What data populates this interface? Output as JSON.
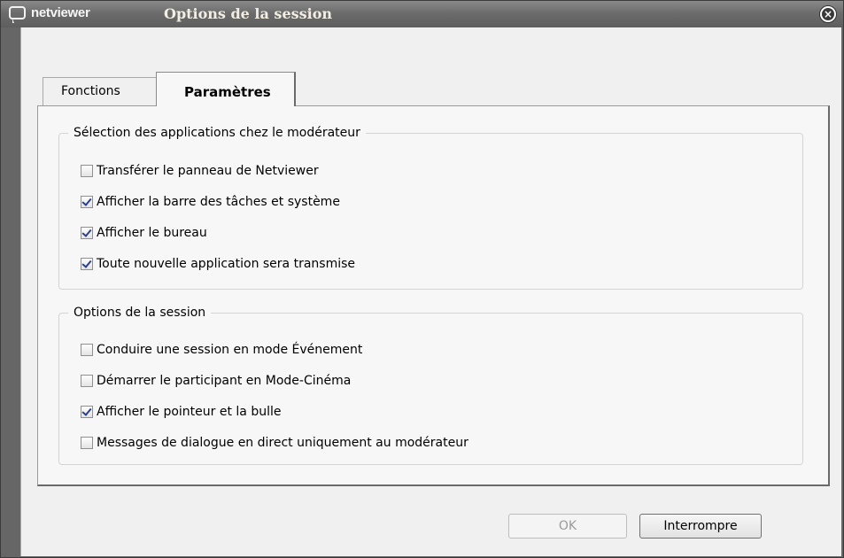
{
  "window": {
    "brand": "netviewer",
    "title": "Options de la session",
    "close_glyph": "×"
  },
  "tabs": [
    {
      "label": "Fonctions",
      "active": false
    },
    {
      "label": "Paramètres",
      "active": true
    }
  ],
  "groups": [
    {
      "legend": "Sélection des applications chez le modérateur",
      "options": [
        {
          "label": "Transférer le panneau de Netviewer",
          "checked": false
        },
        {
          "label": "Afficher la barre des tâches et système",
          "checked": true
        },
        {
          "label": "Afficher le bureau",
          "checked": true
        },
        {
          "label": "Toute nouvelle application sera transmise",
          "checked": true
        }
      ]
    },
    {
      "legend": "Options de la session",
      "options": [
        {
          "label": "Conduire une session en mode Événement",
          "checked": false
        },
        {
          "label": "Démarrer le participant en Mode-Cinéma",
          "checked": false
        },
        {
          "label": "Afficher le pointeur et la bulle",
          "checked": true
        },
        {
          "label": "Messages de dialogue en direct uniquement au modérateur",
          "checked": false
        }
      ]
    }
  ],
  "buttons": {
    "ok_label": "OK",
    "ok_enabled": false,
    "cancel_label": "Interrompre"
  },
  "icons": {
    "logo": "speech-bubble-icon",
    "close": "close-circle-icon"
  }
}
